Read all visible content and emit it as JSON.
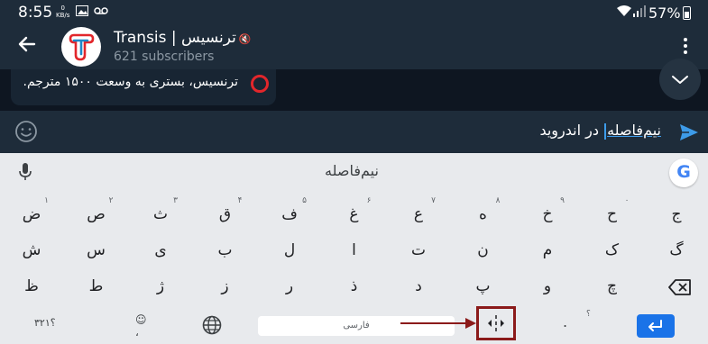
{
  "status_bar": {
    "time": "8:55",
    "net_speed_value": "0",
    "net_speed_unit": "KB/s",
    "battery": "57%"
  },
  "header": {
    "channel_name": "Transis | ترنسیس",
    "subscribers": "621 subscribers"
  },
  "chat": {
    "message_preview": "ترنسیس، بستری به وسعت ۱۵۰۰ مترجم."
  },
  "input": {
    "text_underlined": "نیم‌فاصله",
    "text_rest": " در اندروید"
  },
  "keyboard": {
    "suggestion": "نیم‌فاصله",
    "row1": [
      {
        "label": "ض",
        "hint": "۱"
      },
      {
        "label": "ص",
        "hint": "۲"
      },
      {
        "label": "ث",
        "hint": "۳"
      },
      {
        "label": "ق",
        "hint": "۴"
      },
      {
        "label": "ف",
        "hint": "۵"
      },
      {
        "label": "غ",
        "hint": "۶"
      },
      {
        "label": "ع",
        "hint": "۷"
      },
      {
        "label": "ه",
        "hint": "۸"
      },
      {
        "label": "خ",
        "hint": "۹"
      },
      {
        "label": "ح",
        "hint": "۰"
      },
      {
        "label": "ج",
        "hint": ""
      }
    ],
    "row2": [
      "ش",
      "س",
      "ی",
      "ب",
      "ل",
      "ا",
      "ت",
      "ن",
      "م",
      "ک",
      "گ"
    ],
    "row3": [
      "ظ",
      "ط",
      "ژ",
      "ز",
      "ر",
      "ذ",
      "د",
      "پ",
      "و",
      "چ"
    ],
    "symbols_label": "؟۳۲۱",
    "space_label": "فارسی",
    "period_label": ".",
    "period_hint": "؟"
  },
  "colors": {
    "telegram_bar": "#1e2c3a",
    "chat_background": "#0e1621",
    "accent_blue": "#3d9be9",
    "annotation_red": "#e2262b",
    "highlight_box": "#8b1a1a",
    "keyboard_bg": "#e8eaed",
    "enter_key": "#1a73e8"
  },
  "icons": {
    "back": "arrow-left-icon",
    "menu": "vertical-dots-icon",
    "scroll": "chevron-down-icon",
    "emoji": "smiley-icon",
    "send": "send-icon",
    "mic": "microphone-icon",
    "google": "google-g-icon",
    "globe": "globe-icon",
    "half_space": "half-space-icon",
    "backspace": "backspace-icon",
    "enter": "enter-icon"
  }
}
